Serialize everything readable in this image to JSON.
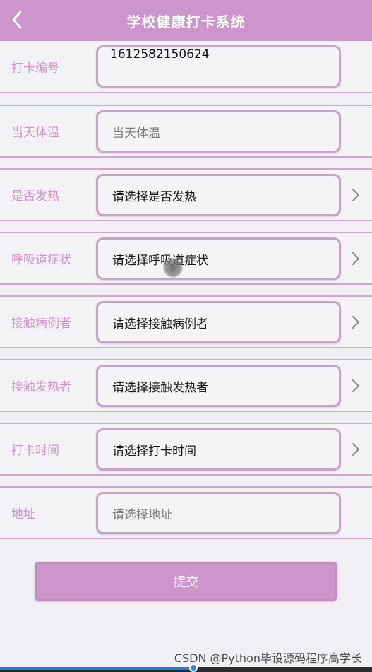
{
  "header": {
    "title": "学校健康打卡系统",
    "back_icon": "chevron-left-icon"
  },
  "form": {
    "rows": [
      {
        "label": "打卡编号",
        "value": "1612582150624",
        "placeholder": "",
        "has_picker": false
      },
      {
        "label": "当天体温",
        "value": "",
        "placeholder": "当天体温",
        "has_picker": false
      },
      {
        "label": "是否发热",
        "value": "请选择是否发热",
        "placeholder": "",
        "has_picker": true
      },
      {
        "label": "呼吸道症状",
        "value": "请选择呼吸道症状",
        "placeholder": "",
        "has_picker": true
      },
      {
        "label": "接触病例者",
        "value": "请选择接触病例者",
        "placeholder": "",
        "has_picker": true
      },
      {
        "label": "接触发热者",
        "value": "请选择接触发热者",
        "placeholder": "",
        "has_picker": true
      },
      {
        "label": "打卡时间",
        "value": "请选择打卡时间",
        "placeholder": "",
        "has_picker": true
      },
      {
        "label": "地址",
        "value": "",
        "placeholder": "请选择地址",
        "has_picker": false
      }
    ],
    "submit_label": "提交"
  },
  "watermark": "CSDN @Python毕设源码程序高学长",
  "video_progress": 0.52,
  "colors": {
    "accent": "#cc95cb",
    "label": "#cc95cb",
    "field_border": "#c8a2c8",
    "background": "#f1eff3"
  }
}
